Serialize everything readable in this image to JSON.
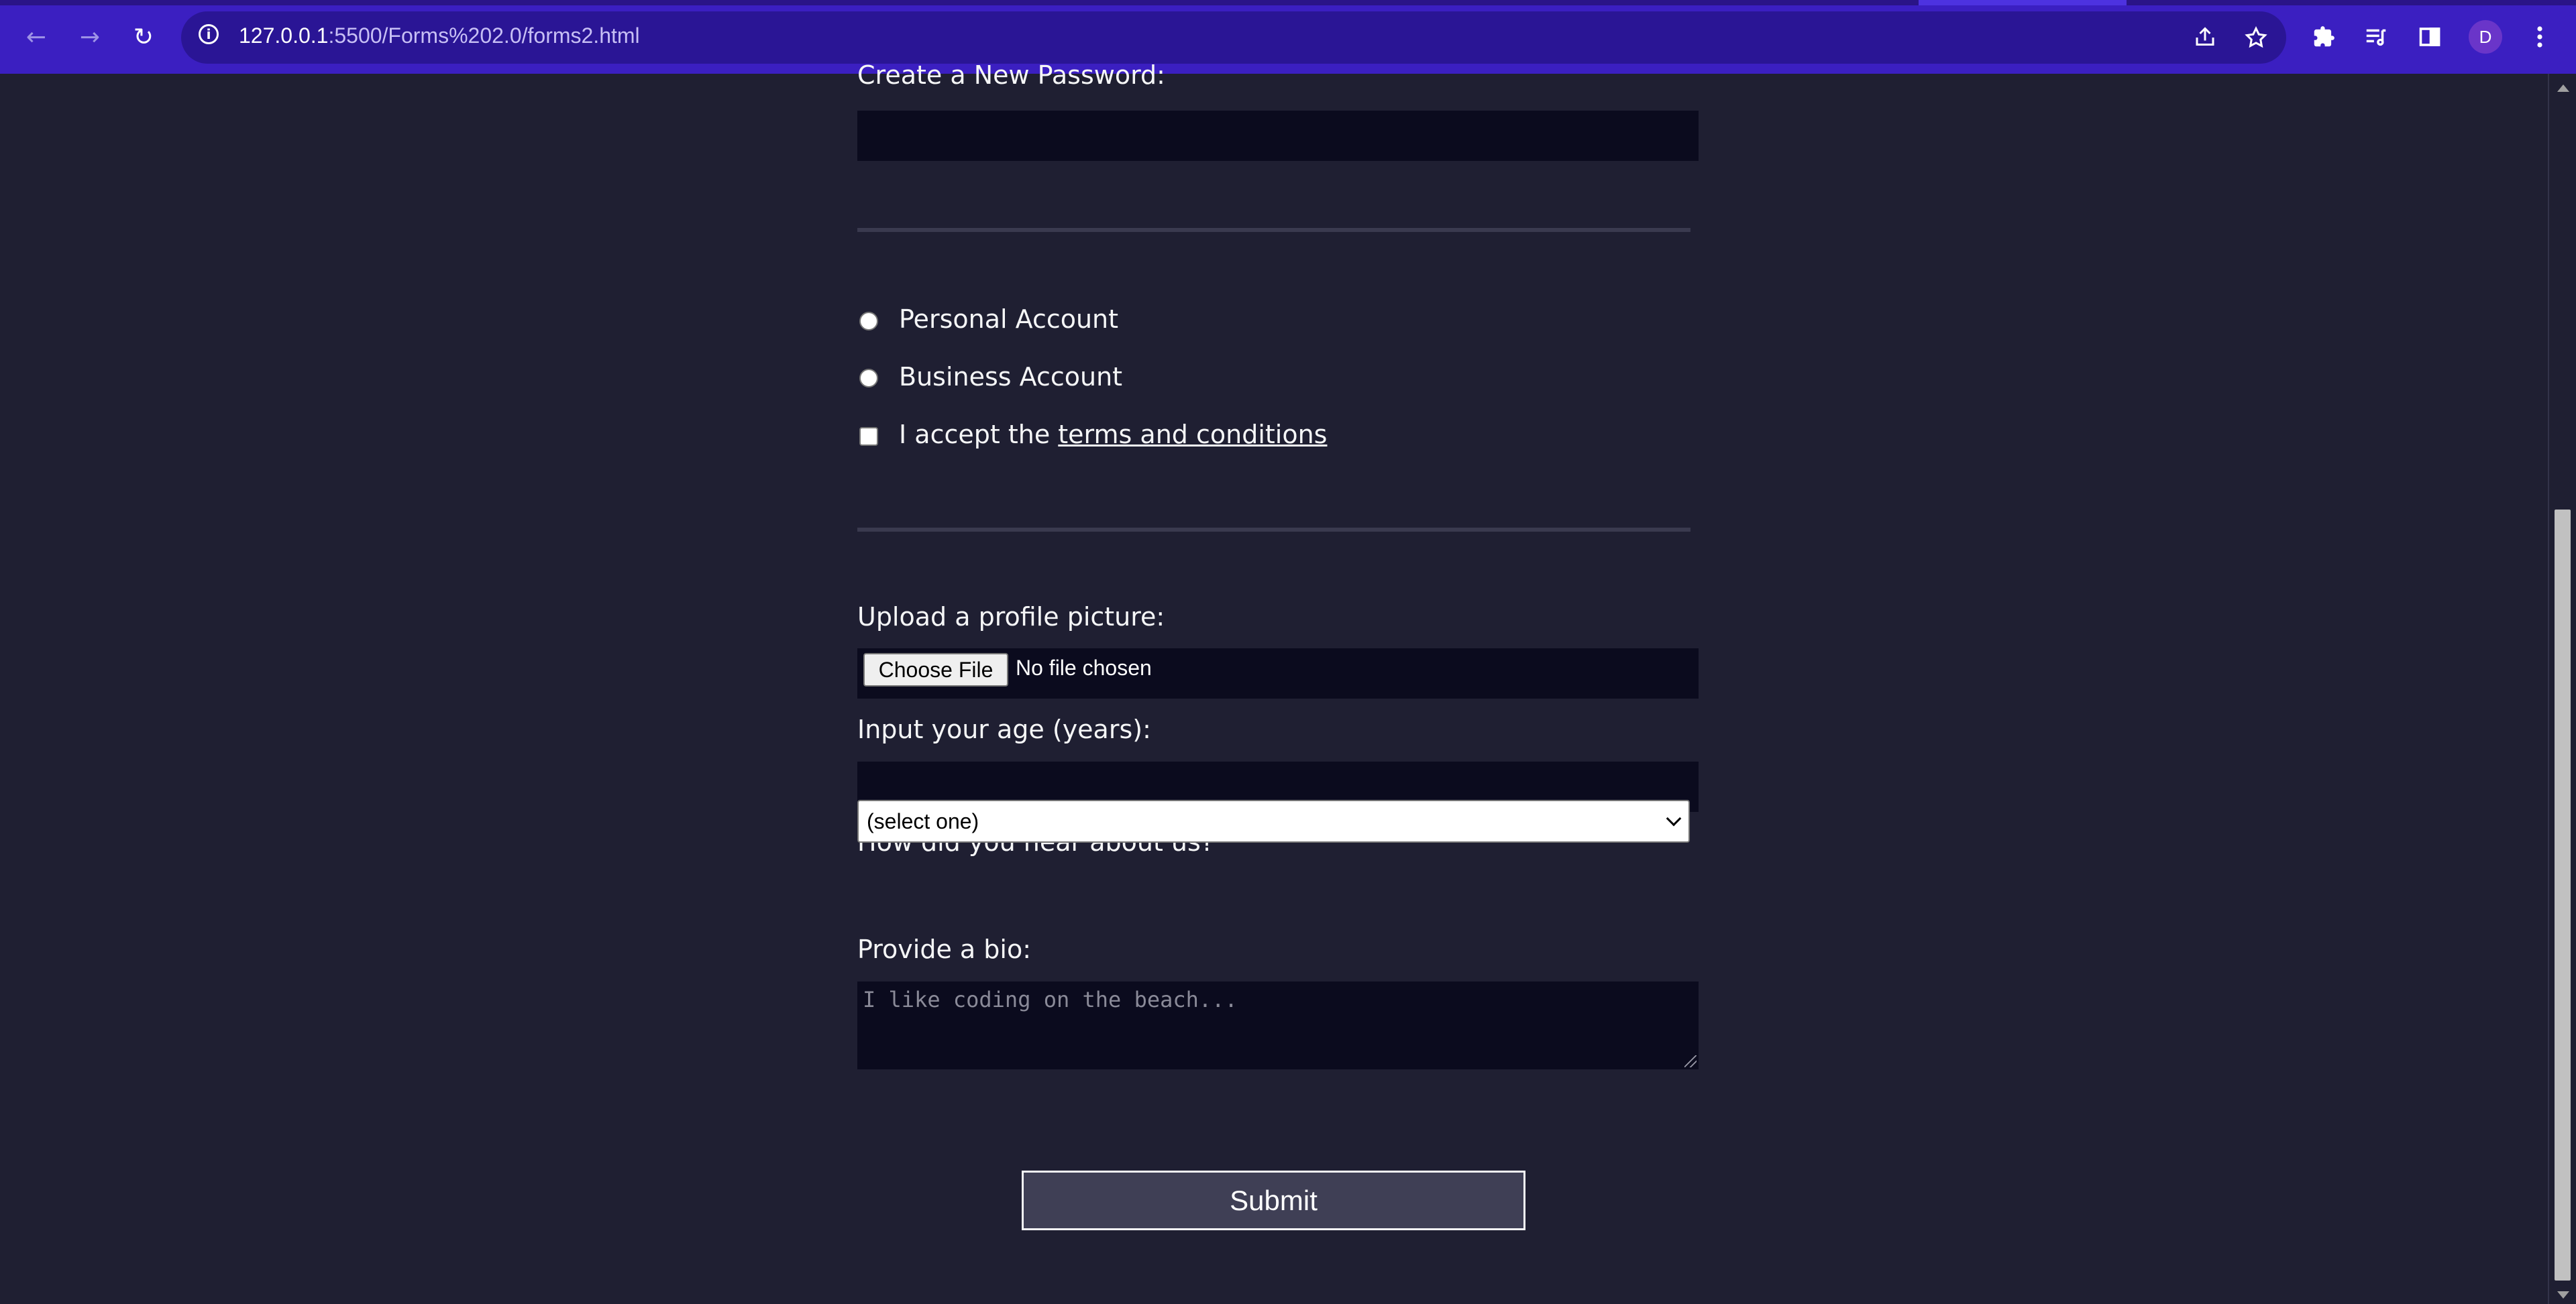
{
  "browser": {
    "url_host": "127.0.0.1",
    "url_rest": ":5500/Forms%202.0/forms2.html",
    "profile_initial": "D",
    "nav": {
      "back": "←",
      "forward": "→",
      "reload": "↻"
    },
    "icons": [
      "share-icon",
      "star-icon",
      "extensions-icon",
      "reading-list-icon",
      "side-panel-icon",
      "menu-icon"
    ],
    "colors": {
      "toolbar": "#3b1fc1",
      "omnibox": "#2a1595"
    }
  },
  "form": {
    "password_label": "Create a New Password:",
    "account_options": [
      "Personal Account",
      "Business Account"
    ],
    "terms_prefix": "I accept the ",
    "terms_link": "terms and conditions",
    "upload_label": "Upload a profile picture:",
    "choose_file": "Choose File",
    "no_file": "No file chosen",
    "age_label": "Input your age (years):",
    "hear_label": "How did you hear about us?",
    "hear_selected": "(select one)",
    "bio_label": "Provide a bio:",
    "bio_placeholder": "I like coding on the beach...",
    "submit": "Submit",
    "colors": {
      "page_bg": "#1f1f32",
      "field_bg": "#0b0b1e",
      "text": "#f5f6f7"
    }
  }
}
